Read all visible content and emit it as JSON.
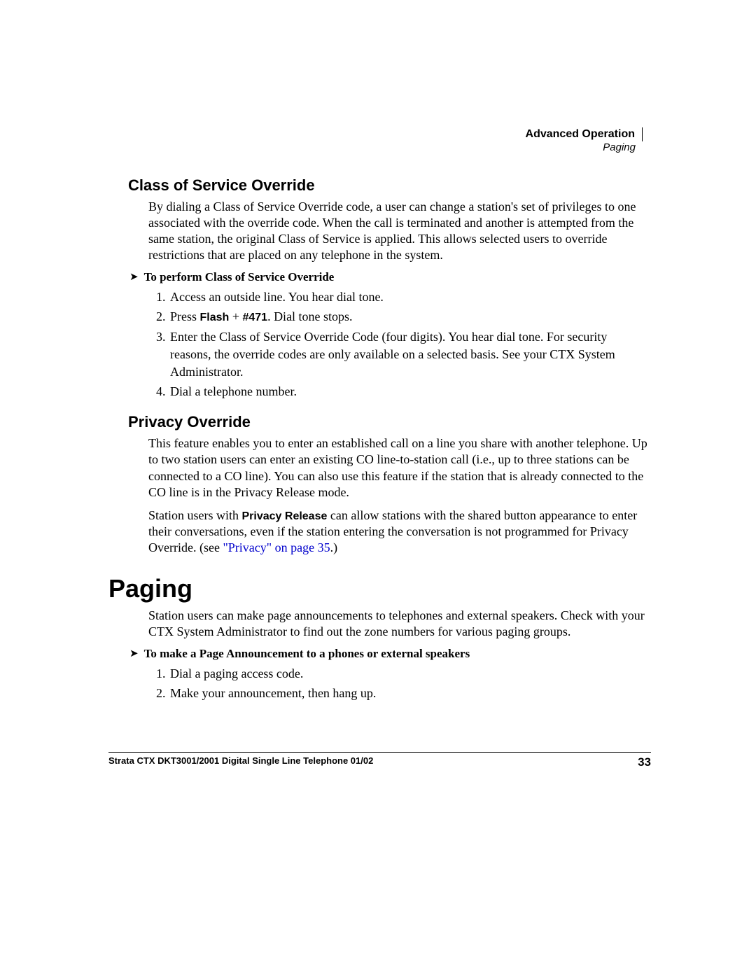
{
  "header": {
    "chapter": "Advanced Operation",
    "section": "Paging"
  },
  "cos": {
    "title": "Class of Service Override",
    "para": "By dialing a Class of Service Override code, a user can change a station's set of privileges to one associated with the override code. When the call is terminated and another is attempted from the same station, the original Class of Service is applied. This allows selected users to override restrictions that are placed on any telephone in the system.",
    "proc_title": "To perform Class of Service Override",
    "steps": {
      "s1": "Access an outside line. You hear dial tone.",
      "s2a": "Press ",
      "s2_key": "Flash",
      "s2b": " + ",
      "s2_code": "#471",
      "s2c": ". Dial tone stops.",
      "s3": "Enter the Class of Service Override Code (four digits). You hear dial tone. For security reasons, the override codes are only available on a selected basis. See your CTX System Administrator.",
      "s4": "Dial a telephone number."
    }
  },
  "priv": {
    "title": "Privacy Override",
    "p1": "This feature enables you to enter an established call on a line you share with another telephone. Up to two station users can enter an existing CO line-to-station call (i.e., up to three stations can be connected to a CO line). You can also use this feature if the station that is already connected to the CO line is in the Privacy Release mode.",
    "p2a": "Station users with ",
    "p2_key": "Privacy Release",
    "p2b": " can allow stations with the shared button appearance to enter their conversations, even if the station entering the conversation is not programmed for Privacy Override. (see ",
    "p2_link": "\"Privacy\" on page 35",
    "p2c": ".)"
  },
  "paging": {
    "title": "Paging",
    "p1": "Station users can make page announcements to telephones and external speakers. Check with your CTX System Administrator to find out the zone numbers for various paging groups.",
    "proc_title": "To make a Page Announcement to a phones or external speakers",
    "steps": {
      "s1": "Dial a paging access code.",
      "s2": "Make your announcement, then hang up."
    }
  },
  "footer": {
    "left": "Strata CTX DKT3001/2001 Digital Single Line Telephone   01/02",
    "page": "33"
  }
}
